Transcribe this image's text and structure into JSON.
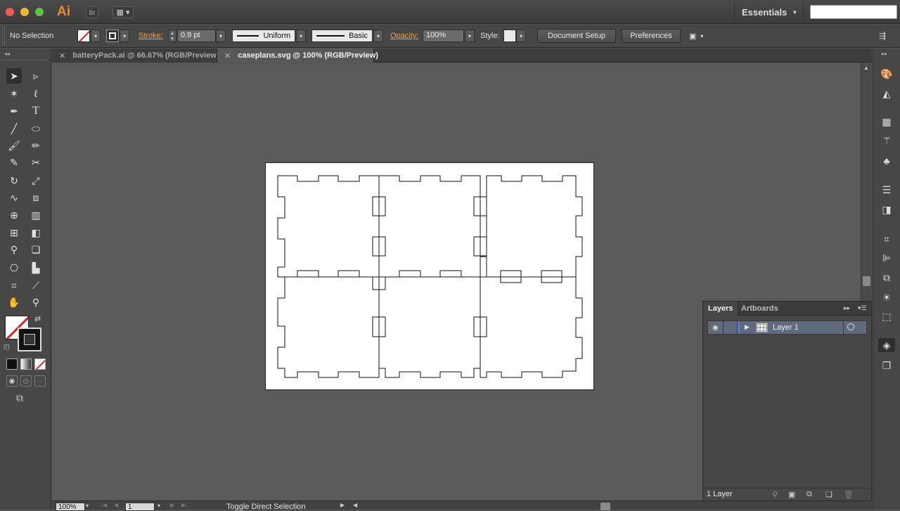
{
  "app": {
    "logo": "Ai",
    "bridge_label": "Br",
    "workspace_label": "Essentials",
    "search_placeholder": ""
  },
  "controlbar": {
    "selection_status": "No Selection",
    "stroke_label": "Stroke:",
    "stroke_weight": "0.9 pt",
    "stroke_profile": "Uniform",
    "brush_definition": "Basic",
    "opacity_label": "Opacity:",
    "opacity_value": "100%",
    "style_label": "Style:",
    "document_setup_label": "Document Setup",
    "preferences_label": "Preferences"
  },
  "tabs": [
    {
      "label": "batteryPack.ai @ 66.67% (RGB/Preview)",
      "active": false
    },
    {
      "label": "caseplans.svg @ 100% (RGB/Preview)",
      "active": true
    }
  ],
  "layers_panel": {
    "tabs": [
      "Layers",
      "Artboards"
    ],
    "layers": [
      {
        "name": "Layer 1"
      }
    ],
    "footer_count": "1 Layer"
  },
  "statusbar": {
    "zoom": "100%",
    "artboard_number": "1",
    "status_text": "Toggle Direct Selection"
  },
  "colors": {
    "accent_orange": "#e88a2c",
    "label_orange": "#f5a04a",
    "layer_color": "#4a7cd8",
    "ui_bg": "#474747",
    "canvas_bg": "#5a5a5a"
  }
}
